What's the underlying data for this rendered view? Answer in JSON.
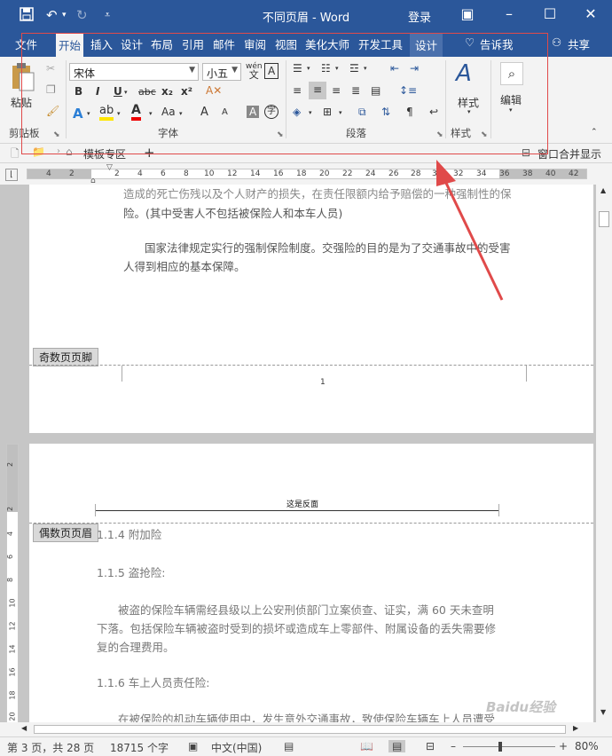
{
  "titlebar": {
    "save_icon": "save-icon",
    "undo_icon": "undo-icon",
    "redo_icon": "redo-icon",
    "title": "不同页眉 - Word",
    "login": "登录"
  },
  "tabs": [
    "文件",
    "开始",
    "插入",
    "设计",
    "布局",
    "引用",
    "邮件",
    "审阅",
    "视图",
    "美化大师",
    "开发工具"
  ],
  "context_tab": "设计",
  "tell_me": "告诉我",
  "share": "共享",
  "ribbon": {
    "clipboard": {
      "paste": "粘贴",
      "label": "剪贴板"
    },
    "font": {
      "name": "宋体",
      "size": "小五",
      "label": "字体",
      "wen": "wén",
      "wen2": "文",
      "bold": "B",
      "italic": "I",
      "underline": "U",
      "strike": "abc",
      "sub": "x₂",
      "sup": "x²",
      "fx": "A",
      "aa": "Aa",
      "grow": "A",
      "shrink": "A",
      "charbox": "A",
      "circle": "字"
    },
    "paragraph": {
      "label": "段落"
    },
    "styles": {
      "label": "样式",
      "btn": "样式"
    },
    "editing": {
      "btn": "编辑"
    }
  },
  "tabstrip": {
    "template": "模板专区",
    "add": "+",
    "merge": "窗口合并显示"
  },
  "ruler": [
    "4",
    "2",
    "2",
    "4",
    "6",
    "8",
    "10",
    "12",
    "14",
    "16",
    "18",
    "20",
    "22",
    "24",
    "26",
    "28",
    "30",
    "32",
    "34",
    "36",
    "38",
    "40",
    "42"
  ],
  "vruler": [
    "2",
    "2",
    "4",
    "6",
    "8",
    "10",
    "12",
    "14",
    "16",
    "18",
    "20"
  ],
  "page1": {
    "line1": "造成的死亡伤残以及个人财产的损失，在责任限额内给予赔偿的一种强制性的保",
    "line2": "险。(其中受害人不包括被保险人和本车人员)",
    "line3": "国家法律规定实行的强制保险制度。交强险的目的是为了交通事故中的受害",
    "line4": "人得到相应的基本保障。",
    "footer_tag": "奇数页页脚",
    "page_no": "1"
  },
  "page2": {
    "header_text": "这是反面",
    "header_tag": "偶数页页眉",
    "h1": "1.1.4   附加险",
    "h2": "1.1.5   盗抢险:",
    "p1": "被盗的保险车辆需经县级以上公安刑侦部门立案侦查、证实，满 60 天未查明",
    "p2": "下落。包括保险车辆被盗时受到的损坏或造成车上零部件、附属设备的丢失需要修",
    "p3": "复的合理费用。",
    "h3": "1.1.6   车上人员责任险:",
    "p4": "在被保险的机动车辆使用中，发生意外交通事故，致使保险车辆车上人员遭受"
  },
  "status": {
    "page": "第 3 页，共 28 页",
    "words": "18715 个字",
    "lang": "中文(中国)",
    "zoom": "80%"
  },
  "watermark": "Baidu经验",
  "colors": {
    "accent": "#2b579a",
    "annotation": "#e04a4a"
  }
}
